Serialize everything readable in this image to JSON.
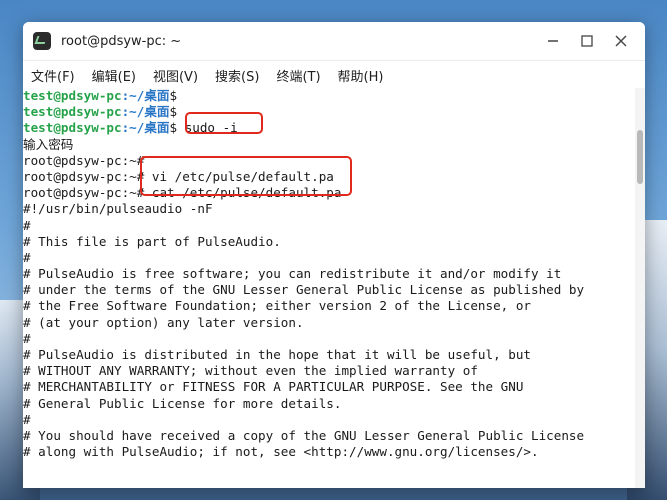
{
  "window": {
    "title": "root@pdsyw-pc: ~"
  },
  "menu": [
    "文件(F)",
    "编辑(E)",
    "视图(V)",
    "搜索(S)",
    "终端(T)",
    "帮助(H)"
  ],
  "terminal": {
    "lines": [
      {
        "user": "test@pdsyw-pc",
        "path": ":~/桌面",
        "end": "$",
        "cmd": ""
      },
      {
        "user": "test@pdsyw-pc",
        "path": ":~/桌面",
        "end": "$",
        "cmd": ""
      },
      {
        "user": "test@pdsyw-pc",
        "path": ":~/桌面",
        "end": "$ ",
        "cmd": "sudo -i"
      },
      {
        "text": "输入密码"
      },
      {
        "text": "root@pdsyw-pc:~# "
      },
      {
        "text": "root@pdsyw-pc:~# vi /etc/pulse/default.pa"
      },
      {
        "text": "root@pdsyw-pc:~# cat /etc/pulse/default.pa"
      },
      {
        "text": "#!/usr/bin/pulseaudio -nF"
      },
      {
        "text": "#"
      },
      {
        "text": "# This file is part of PulseAudio."
      },
      {
        "text": "#"
      },
      {
        "text": "# PulseAudio is free software; you can redistribute it and/or modify it"
      },
      {
        "text": "# under the terms of the GNU Lesser General Public License as published by"
      },
      {
        "text": "# the Free Software Foundation; either version 2 of the License, or"
      },
      {
        "text": "# (at your option) any later version."
      },
      {
        "text": "#"
      },
      {
        "text": "# PulseAudio is distributed in the hope that it will be useful, but"
      },
      {
        "text": "# WITHOUT ANY WARRANTY; without even the implied warranty of"
      },
      {
        "text": "# MERCHANTABILITY or FITNESS FOR A PARTICULAR PURPOSE. See the GNU"
      },
      {
        "text": "# General Public License for more details."
      },
      {
        "text": "#"
      },
      {
        "text": "# You should have received a copy of the GNU Lesser General Public License"
      },
      {
        "text": "# along with PulseAudio; if not, see <http://www.gnu.org/licenses/>."
      }
    ]
  },
  "colors": {
    "highlight": "#e0281c",
    "prompt_user": "#27a34a",
    "prompt_path": "#2a76c6"
  }
}
